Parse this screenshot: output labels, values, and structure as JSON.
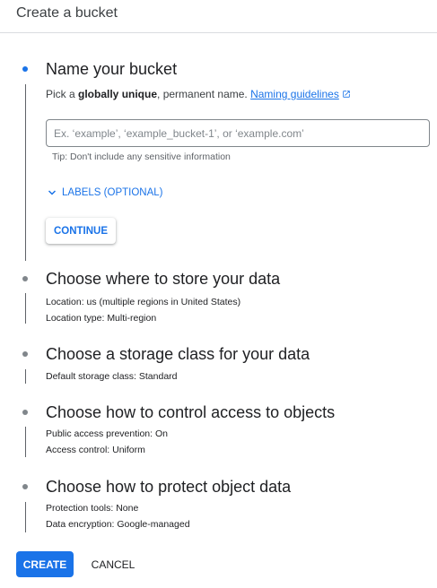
{
  "header": {
    "title": "Create a bucket"
  },
  "step1": {
    "title": "Name your bucket",
    "desc_prefix": "Pick a ",
    "desc_bold": "globally unique",
    "desc_suffix": ", permanent name. ",
    "link_label": "Naming guidelines",
    "input_value": "",
    "input_placeholder": "Ex. ‘example’, ‘example_bucket-1’, or ‘example.com’",
    "tip": "Tip: Don't include any sensitive information",
    "labels_toggle": "LABELS (OPTIONAL)",
    "continue_label": "CONTINUE"
  },
  "step2": {
    "title": "Choose where to store your data",
    "location_label": "Location:",
    "location_value": "us (multiple regions in United States)",
    "type_label": "Location type:",
    "type_value": "Multi-region"
  },
  "step3": {
    "title": "Choose a storage class for your data",
    "class_label": "Default storage class:",
    "class_value": "Standard"
  },
  "step4": {
    "title": "Choose how to control access to objects",
    "prevention_label": "Public access prevention:",
    "prevention_value": "On",
    "control_label": "Access control:",
    "control_value": "Uniform"
  },
  "step5": {
    "title": "Choose how to protect object data",
    "tools_label": "Protection tools:",
    "tools_value": "None",
    "encryption_label": "Data encryption:",
    "encryption_value": "Google-managed"
  },
  "footer": {
    "create_label": "CREATE",
    "cancel_label": "CANCEL"
  },
  "colors": {
    "accent": "#1a73e8",
    "active_step": "#1a73e8",
    "inactive_step": "#80868b",
    "divider": "#dadce0"
  },
  "icons": {
    "step_indicator": "dot",
    "guidelines_link": "open-in-new-icon",
    "labels_toggle": "chevron-down-icon"
  }
}
